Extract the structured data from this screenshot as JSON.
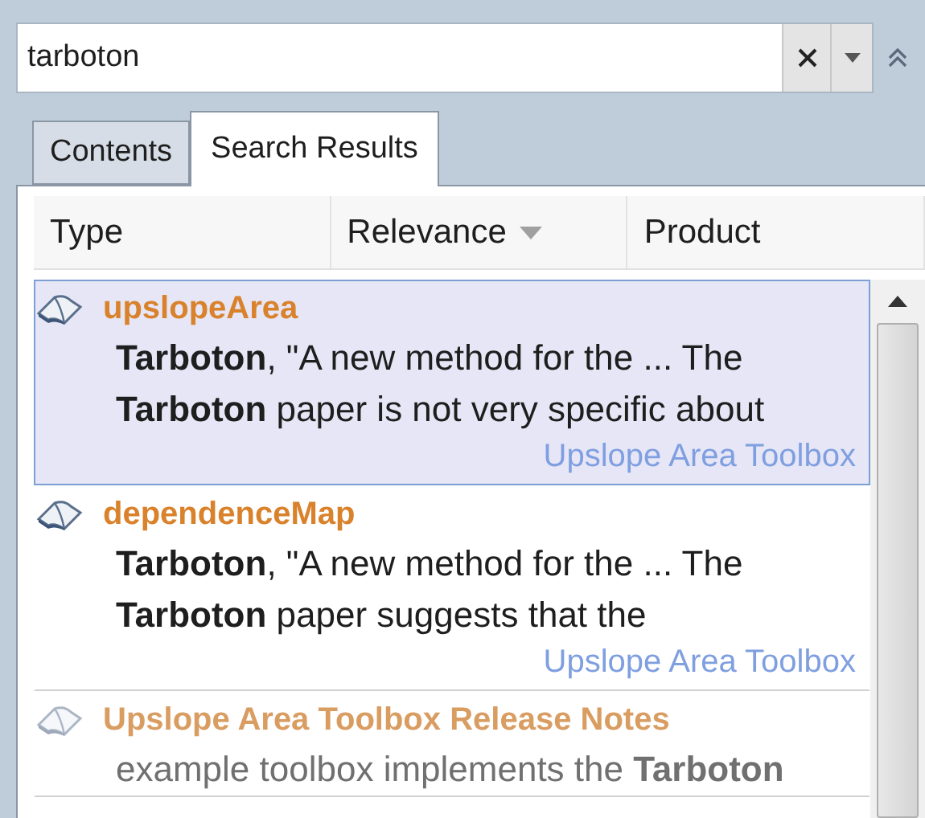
{
  "search": {
    "value": "tarboton"
  },
  "tabs": [
    {
      "label": "Contents",
      "selected": false
    },
    {
      "label": "Search Results",
      "selected": true
    }
  ],
  "columns": [
    {
      "label": "Type",
      "sorted": false
    },
    {
      "label": "Relevance",
      "sorted": true
    },
    {
      "label": "Product",
      "sorted": false
    }
  ],
  "results": [
    {
      "title": "upslopeArea",
      "snippet": [
        "**Tarboton**, \"A new method for the ... The",
        "**Tarboton** paper is not very specific about"
      ],
      "source": "Upslope Area Toolbox",
      "selected": true,
      "faded": false
    },
    {
      "title": "dependenceMap",
      "snippet": [
        "**Tarboton**, \"A new method for the ... The",
        "**Tarboton** paper suggests that the"
      ],
      "source": "Upslope Area Toolbox",
      "selected": false,
      "faded": false
    },
    {
      "title": "Upslope Area Toolbox Release Notes",
      "snippet": [
        "example toolbox implements the **Tarboton**"
      ],
      "selected": false,
      "faded": true
    }
  ]
}
